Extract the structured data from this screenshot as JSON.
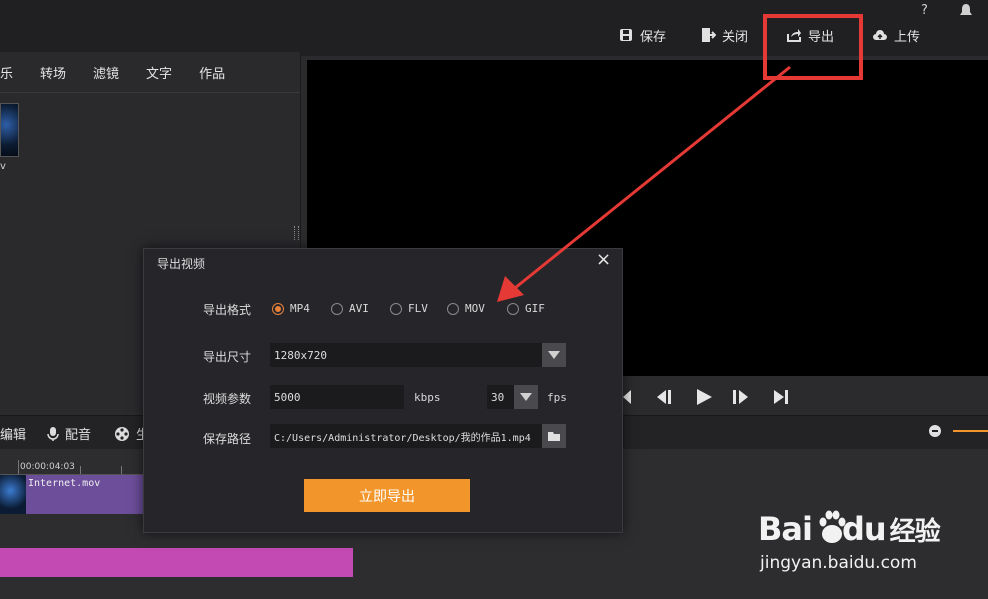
{
  "topbar": {
    "help": "?",
    "save": "保存",
    "close": "关闭",
    "export": "导出",
    "upload": "上传"
  },
  "left_tabs": [
    "乐",
    "转场",
    "滤镜",
    "文字",
    "作品"
  ],
  "media_caption": "v",
  "edit_bar": {
    "edit": "编辑",
    "dub": "配音",
    "subtitle": "生"
  },
  "timeline": {
    "timecode": "00:00:04:03",
    "clip_name": "Internet.mov"
  },
  "dialog": {
    "title": "导出视频",
    "close": "×",
    "format_label": "导出格式",
    "formats": [
      "MP4",
      "AVI",
      "FLV",
      "MOV",
      "GIF"
    ],
    "selected_format": "MP4",
    "size_label": "导出尺寸",
    "size_value": "1280x720",
    "params_label": "视频参数",
    "bitrate": "5000",
    "bitrate_unit": "kbps",
    "fps": "30",
    "fps_unit": "fps",
    "path_label": "保存路径",
    "path_value": "C:/Users/Administrator/Desktop/我的作品1.mp4",
    "export_now": "立即导出"
  },
  "watermark": {
    "brand_a": "Bai",
    "brand_b": "du",
    "brand_c": "经验",
    "url": "jingyan.baidu.com"
  },
  "colors": {
    "accent": "#f2962b",
    "annotation": "#e53935",
    "clip": "#6c4e9b",
    "track": "#c24ab2"
  }
}
